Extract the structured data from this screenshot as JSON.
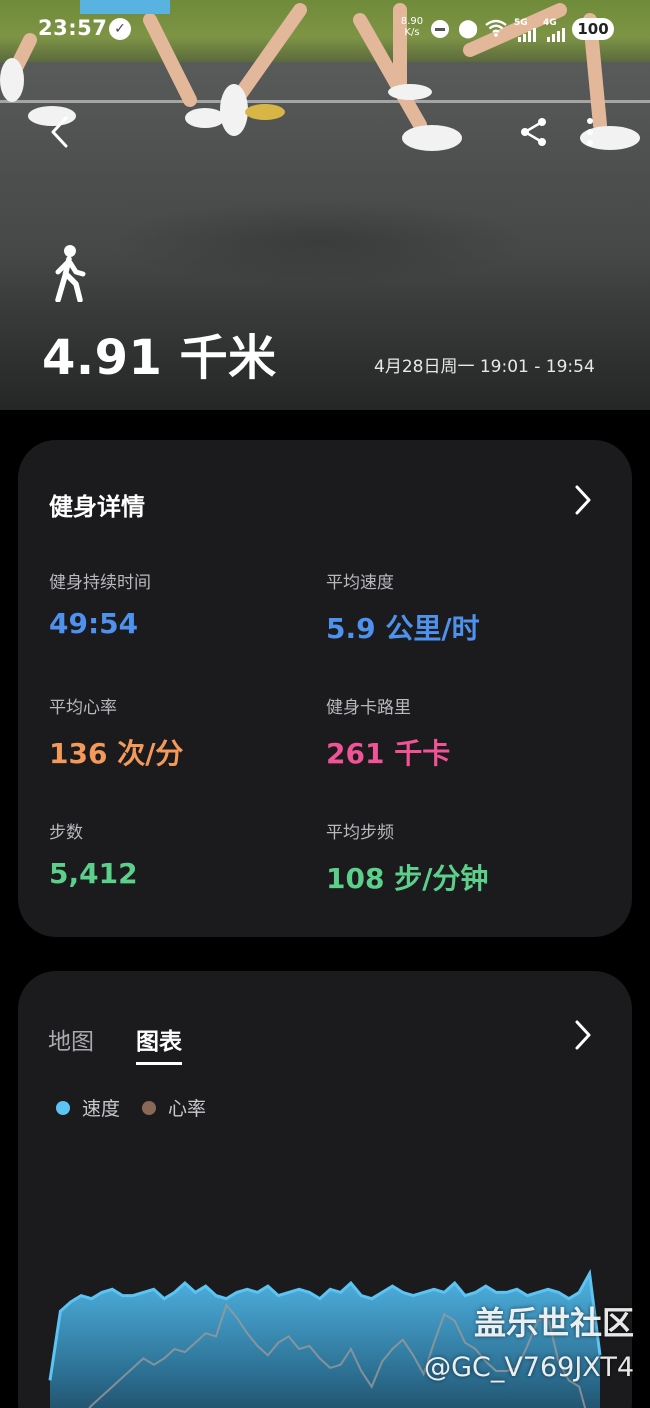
{
  "status_bar": {
    "time": "23:57",
    "net_rate": "8.90\nK/s",
    "signal_1": "5G",
    "signal_2": "4G",
    "battery": "100",
    "icons": [
      "check-icon",
      "dnd-icon",
      "location-icon",
      "wifi-icon",
      "signal-icon",
      "battery-icon"
    ]
  },
  "hero": {
    "activity_icon": "walk-icon",
    "distance": "4.91 千米",
    "date_range": "4月28日周一 19:01 - 19:54"
  },
  "details": {
    "title": "健身详情",
    "metrics": [
      {
        "label": "健身持续时间",
        "value": "49:54",
        "color": "#4e92ee"
      },
      {
        "label": "平均速度",
        "value": "5.9 公里/时",
        "color": "#4e92ee"
      },
      {
        "label": "平均心率",
        "value": "136 次/分",
        "color": "#f39a5a"
      },
      {
        "label": "健身卡路里",
        "value": "261 千卡",
        "color": "#f05396"
      },
      {
        "label": "步数",
        "value": "5,412",
        "color": "#5ccf8a"
      },
      {
        "label": "平均步频",
        "value": "108 步/分钟",
        "color": "#5ccf8a"
      }
    ]
  },
  "chart_card": {
    "tabs": [
      {
        "label": "地图",
        "active": false
      },
      {
        "label": "图表",
        "active": true
      }
    ],
    "legend": [
      {
        "label": "速度",
        "color": "#5cc3f2"
      },
      {
        "label": "心率",
        "color": "#8a6858"
      }
    ]
  },
  "chart_data": {
    "type": "area",
    "series": [
      {
        "name": "速度",
        "color": "#5cc3f2",
        "values": [
          3.2,
          5.4,
          5.7,
          5.9,
          5.8,
          6.0,
          6.1,
          5.9,
          5.9,
          6.0,
          6.1,
          5.8,
          6.0,
          6.3,
          6.0,
          6.2,
          5.9,
          5.8,
          6.0,
          6.1,
          6.0,
          6.2,
          5.9,
          6.0,
          6.1,
          6.0,
          5.8,
          6.1,
          6.0,
          6.3,
          5.9,
          5.8,
          6.0,
          6.2,
          6.0,
          5.9,
          6.0,
          6.1,
          6.0,
          6.3,
          5.9,
          6.0,
          6.2,
          6.0,
          6.0,
          6.1,
          5.9,
          6.0,
          6.1,
          6.0,
          5.8,
          6.0,
          6.6,
          4.0
        ]
      },
      {
        "name": "心率",
        "color": "#9a9a9a",
        "values": [
          0.6,
          1.0,
          1.4,
          2.0,
          2.4,
          2.7,
          3.0,
          3.3,
          3.6,
          3.9,
          3.7,
          3.9,
          4.2,
          4.1,
          4.4,
          4.7,
          4.6,
          5.6,
          5.2,
          4.7,
          4.3,
          4.0,
          4.4,
          4.6,
          4.2,
          4.3,
          3.9,
          3.6,
          3.7,
          4.2,
          3.5,
          3.0,
          3.8,
          4.2,
          4.5,
          4.0,
          3.4,
          4.4,
          5.3,
          5.1,
          4.4,
          4.2,
          3.8,
          3.5,
          3.5,
          3.6,
          4.3,
          5.1,
          5.2,
          3.8,
          3.2,
          3.0,
          1.8,
          1.2
        ]
      }
    ],
    "ylim": [
      0,
      7
    ],
    "grid": false,
    "legend_position": "top-left"
  },
  "watermark": {
    "brand": "盖乐世社区",
    "user": "@GC_V769JXT4"
  }
}
